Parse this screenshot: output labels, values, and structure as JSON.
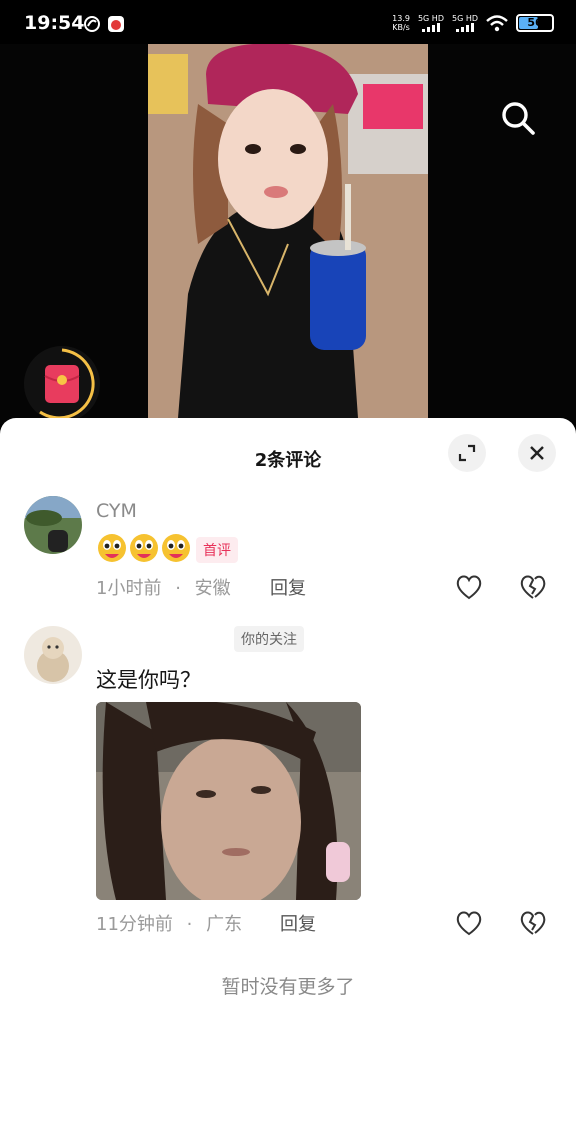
{
  "status_bar": {
    "time": "19:54",
    "net_speed_value": "13.9",
    "net_speed_unit": "KB/s",
    "sim1_label": "5G HD",
    "sim2_label": "5G HD",
    "battery_level": "56",
    "icons": [
      "app-circle-icon",
      "app-notification-icon",
      "wifi-icon",
      "battery-icon"
    ]
  },
  "video": {
    "search_icon": "search-icon",
    "widget_icon": "red-packet-icon"
  },
  "comments_sheet": {
    "title": "2条评论",
    "expand_icon": "expand-icon",
    "close_icon": "close-icon",
    "comments": [
      {
        "username": "CYM",
        "emojis": [
          "cute-face-emoji",
          "cute-face-emoji",
          "cute-face-emoji"
        ],
        "badge": "首评",
        "time": "1小时前",
        "location": "安徽",
        "reply_label": "回复"
      },
      {
        "username": "ᅟᅟᅟᅟᅟᅟᅟᅟᅟ",
        "badge": "你的关注",
        "text": "这是你吗？",
        "time": "11分钟前",
        "location": "广东",
        "reply_label": "回复"
      }
    ],
    "end_text": "暂时没有更多了"
  }
}
